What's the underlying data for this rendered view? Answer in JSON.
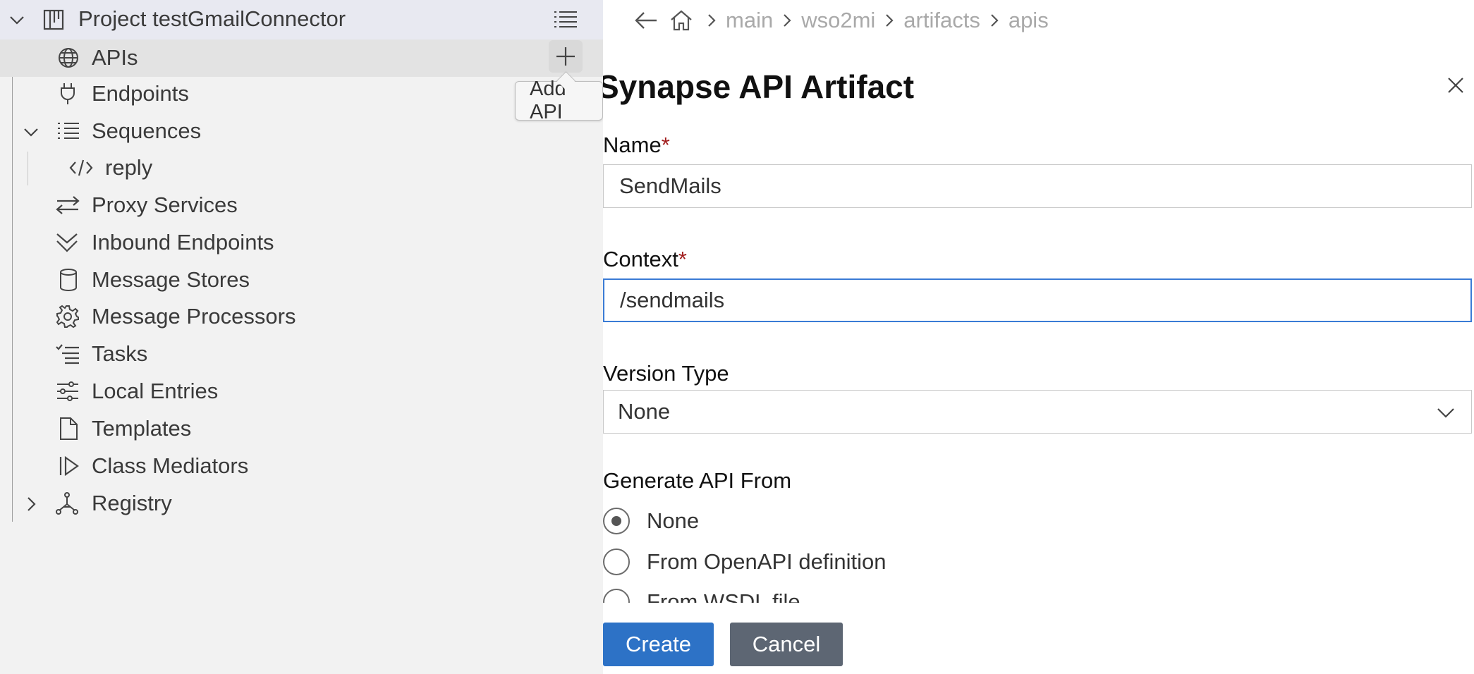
{
  "explorer": {
    "project_label": "Project testGmailConnector",
    "items": [
      {
        "label": "APIs",
        "icon": "globe-icon"
      },
      {
        "label": "Endpoints",
        "icon": "plug-icon"
      },
      {
        "label": "Sequences",
        "icon": "list-icon"
      },
      {
        "label": "reply",
        "icon": "code-icon"
      },
      {
        "label": "Proxy Services",
        "icon": "arrows-swap-icon"
      },
      {
        "label": "Inbound Endpoints",
        "icon": "double-chevron-down-icon"
      },
      {
        "label": "Message Stores",
        "icon": "database-icon"
      },
      {
        "label": "Message Processors",
        "icon": "gear-icon"
      },
      {
        "label": "Tasks",
        "icon": "checklist-icon"
      },
      {
        "label": "Local Entries",
        "icon": "sliders-icon"
      },
      {
        "label": "Templates",
        "icon": "file-icon"
      },
      {
        "label": "Class Mediators",
        "icon": "play-bar-icon"
      },
      {
        "label": "Registry",
        "icon": "network-icon"
      }
    ],
    "tooltip": "Add API"
  },
  "breadcrumb": {
    "items": [
      "main",
      "wso2mi",
      "artifacts",
      "apis"
    ]
  },
  "form": {
    "title": "Synapse API Artifact",
    "name_label": "Name",
    "name_value": "SendMails",
    "context_label": "Context",
    "context_value": "/sendmails",
    "required_mark": "*",
    "version_type_label": "Version Type",
    "version_type_value": "None",
    "generate_label": "Generate API From",
    "generate_options": [
      "None",
      "From OpenAPI definition",
      "From WSDL file"
    ],
    "generate_selected": "None",
    "create_label": "Create",
    "cancel_label": "Cancel"
  },
  "colors": {
    "primary_button": "#2d72c6",
    "secondary_button": "#5d6673",
    "focus_border": "#3a7bd5",
    "required": "#a11d1d"
  }
}
